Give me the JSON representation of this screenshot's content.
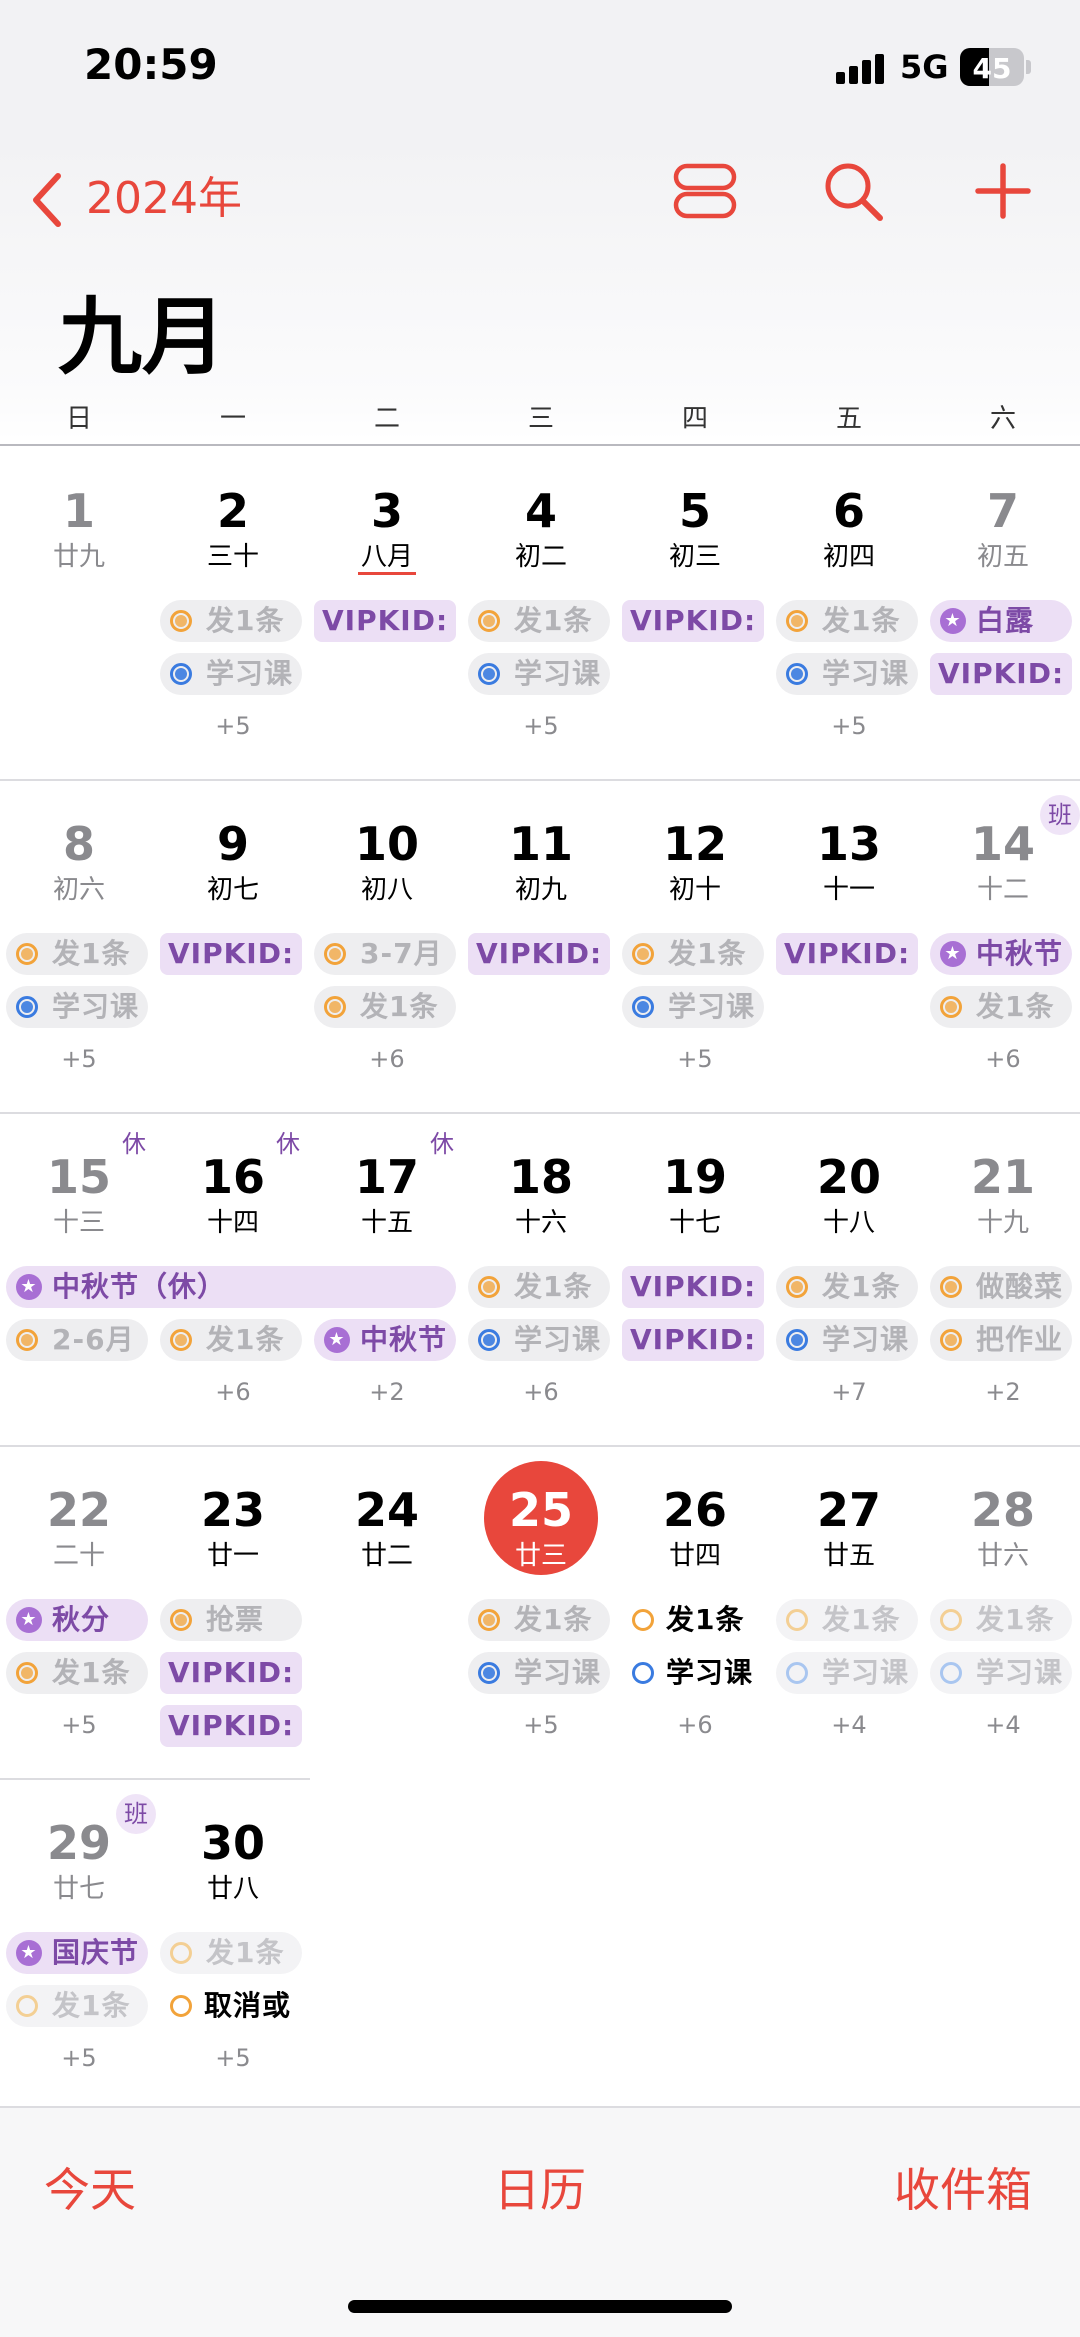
{
  "status": {
    "time": "20:59",
    "network": "5G",
    "battery": "45",
    "battery_level": 0.45
  },
  "nav": {
    "back_label": "2024年",
    "month": "九月"
  },
  "weekdays": [
    "日",
    "一",
    "二",
    "三",
    "四",
    "五",
    "六"
  ],
  "weeks": [
    {
      "days": [
        {
          "num": "1",
          "lunar": "廿九",
          "weekend": true,
          "events": [],
          "more": ""
        },
        {
          "num": "2",
          "lunar": "三十",
          "events": [
            {
              "kind": "o",
              "label": "发1条"
            },
            {
              "kind": "b",
              "label": "学习课"
            }
          ],
          "more": "+5"
        },
        {
          "num": "3",
          "lunar": "八月",
          "lunar_underline": true,
          "events": [
            {
              "kind": "v",
              "label": "VIPKID:"
            }
          ],
          "more": ""
        },
        {
          "num": "4",
          "lunar": "初二",
          "events": [
            {
              "kind": "o",
              "label": "发1条"
            },
            {
              "kind": "b",
              "label": "学习课"
            }
          ],
          "more": "+5"
        },
        {
          "num": "5",
          "lunar": "初三",
          "events": [
            {
              "kind": "v",
              "label": "VIPKID:"
            }
          ],
          "more": ""
        },
        {
          "num": "6",
          "lunar": "初四",
          "events": [
            {
              "kind": "o",
              "label": "发1条"
            },
            {
              "kind": "b",
              "label": "学习课"
            }
          ],
          "more": "+5"
        },
        {
          "num": "7",
          "lunar": "初五",
          "weekend": true,
          "events": [
            {
              "kind": "s",
              "label": "白露"
            },
            {
              "kind": "v",
              "label": "VIPKID:"
            }
          ],
          "more": ""
        }
      ]
    },
    {
      "days": [
        {
          "num": "8",
          "lunar": "初六",
          "weekend": true,
          "events": [
            {
              "kind": "o",
              "label": "发1条"
            },
            {
              "kind": "b",
              "label": "学习课"
            }
          ],
          "more": "+5"
        },
        {
          "num": "9",
          "lunar": "初七",
          "events": [
            {
              "kind": "v",
              "label": "VIPKID:"
            }
          ],
          "more": ""
        },
        {
          "num": "10",
          "lunar": "初八",
          "events": [
            {
              "kind": "o",
              "label": "3-7月"
            },
            {
              "kind": "o",
              "label": "发1条"
            }
          ],
          "more": "+6"
        },
        {
          "num": "11",
          "lunar": "初九",
          "events": [
            {
              "kind": "v",
              "label": "VIPKID:"
            }
          ],
          "more": ""
        },
        {
          "num": "12",
          "lunar": "初十",
          "events": [
            {
              "kind": "o",
              "label": "发1条"
            },
            {
              "kind": "b",
              "label": "学习课"
            }
          ],
          "more": "+5"
        },
        {
          "num": "13",
          "lunar": "十一",
          "events": [
            {
              "kind": "v",
              "label": "VIPKID:"
            }
          ],
          "more": ""
        },
        {
          "num": "14",
          "lunar": "十二",
          "weekend": true,
          "badge": "班",
          "events": [
            {
              "kind": "s",
              "label": "中秋节"
            },
            {
              "kind": "o",
              "label": "发1条"
            }
          ],
          "more": "+6"
        }
      ]
    },
    {
      "days": [
        {
          "num": "15",
          "lunar": "十三",
          "weekend": true,
          "badge": "休",
          "events": [
            {
              "kind": "s",
              "label": "中秋节（休）",
              "span": 3
            },
            {
              "kind": "o",
              "label": "2-6月"
            }
          ],
          "more": ""
        },
        {
          "num": "16",
          "lunar": "十四",
          "badge": "休",
          "events": [
            {
              "kind": "skip"
            },
            {
              "kind": "o",
              "label": "发1条"
            }
          ],
          "more": "+6"
        },
        {
          "num": "17",
          "lunar": "十五",
          "badge": "休",
          "events": [
            {
              "kind": "skip"
            },
            {
              "kind": "s",
              "label": "中秋节"
            }
          ],
          "more": "+2"
        },
        {
          "num": "18",
          "lunar": "十六",
          "events": [
            {
              "kind": "o",
              "label": "发1条"
            },
            {
              "kind": "b",
              "label": "学习课"
            }
          ],
          "more": "+6"
        },
        {
          "num": "19",
          "lunar": "十七",
          "events": [
            {
              "kind": "v",
              "label": "VIPKID:"
            },
            {
              "kind": "v",
              "label": "VIPKID:"
            }
          ],
          "more": ""
        },
        {
          "num": "20",
          "lunar": "十八",
          "events": [
            {
              "kind": "o",
              "label": "发1条"
            },
            {
              "kind": "b",
              "label": "学习课"
            }
          ],
          "more": "+7"
        },
        {
          "num": "21",
          "lunar": "十九",
          "weekend": true,
          "events": [
            {
              "kind": "o",
              "label": "做酸菜"
            },
            {
              "kind": "o",
              "label": "把作业"
            }
          ],
          "more": "+2"
        }
      ]
    },
    {
      "days": [
        {
          "num": "22",
          "lunar": "二十",
          "weekend": true,
          "events": [
            {
              "kind": "s",
              "label": "秋分"
            },
            {
              "kind": "o",
              "label": "发1条"
            }
          ],
          "more": "+5"
        },
        {
          "num": "23",
          "lunar": "廿一",
          "events": [
            {
              "kind": "o",
              "label": "抢票"
            },
            {
              "kind": "v",
              "label": "VIPKID:"
            },
            {
              "kind": "v",
              "label": "VIPKID:"
            }
          ],
          "more": ""
        },
        {
          "num": "24",
          "lunar": "廿二",
          "events": [],
          "more": ""
        },
        {
          "num": "25",
          "lunar": "廿三",
          "today": true,
          "events": [
            {
              "kind": "o",
              "label": "发1条"
            },
            {
              "kind": "b",
              "label": "学习课"
            }
          ],
          "more": "+5"
        },
        {
          "num": "26",
          "lunar": "廿四",
          "events": [
            {
              "kind": "oo",
              "label": "发1条"
            },
            {
              "kind": "bo",
              "label": "学习课"
            }
          ],
          "more": "+6"
        },
        {
          "num": "27",
          "lunar": "廿五",
          "events": [
            {
              "kind": "fo",
              "label": "发1条"
            },
            {
              "kind": "fb",
              "label": "学习课"
            }
          ],
          "more": "+4"
        },
        {
          "num": "28",
          "lunar": "廿六",
          "weekend": true,
          "events": [
            {
              "kind": "fo",
              "label": "发1条"
            },
            {
              "kind": "fb",
              "label": "学习课"
            }
          ],
          "more": "+4"
        }
      ]
    },
    {
      "days": [
        {
          "num": "29",
          "lunar": "廿七",
          "weekend": true,
          "badge": "班",
          "events": [
            {
              "kind": "s",
              "label": "国庆节"
            },
            {
              "kind": "fo",
              "label": "发1条"
            }
          ],
          "more": "+5"
        },
        {
          "num": "30",
          "lunar": "廿八",
          "events": [
            {
              "kind": "fo",
              "label": "发1条"
            },
            {
              "kind": "oo",
              "label": "取消或"
            }
          ],
          "more": "+5"
        }
      ]
    }
  ],
  "tabbar": {
    "today": "今天",
    "calendars": "日历",
    "inbox": "收件箱"
  },
  "icons": {
    "back": "chevron-left-icon",
    "list": "list-view-icon",
    "search": "search-icon",
    "add": "plus-icon",
    "holiday": "star-icon"
  },
  "colors": {
    "accent": "#e8473c",
    "holiday": "#a86fd4",
    "reminder_orange": "#f2a33a",
    "reminder_blue": "#3a7be0"
  }
}
